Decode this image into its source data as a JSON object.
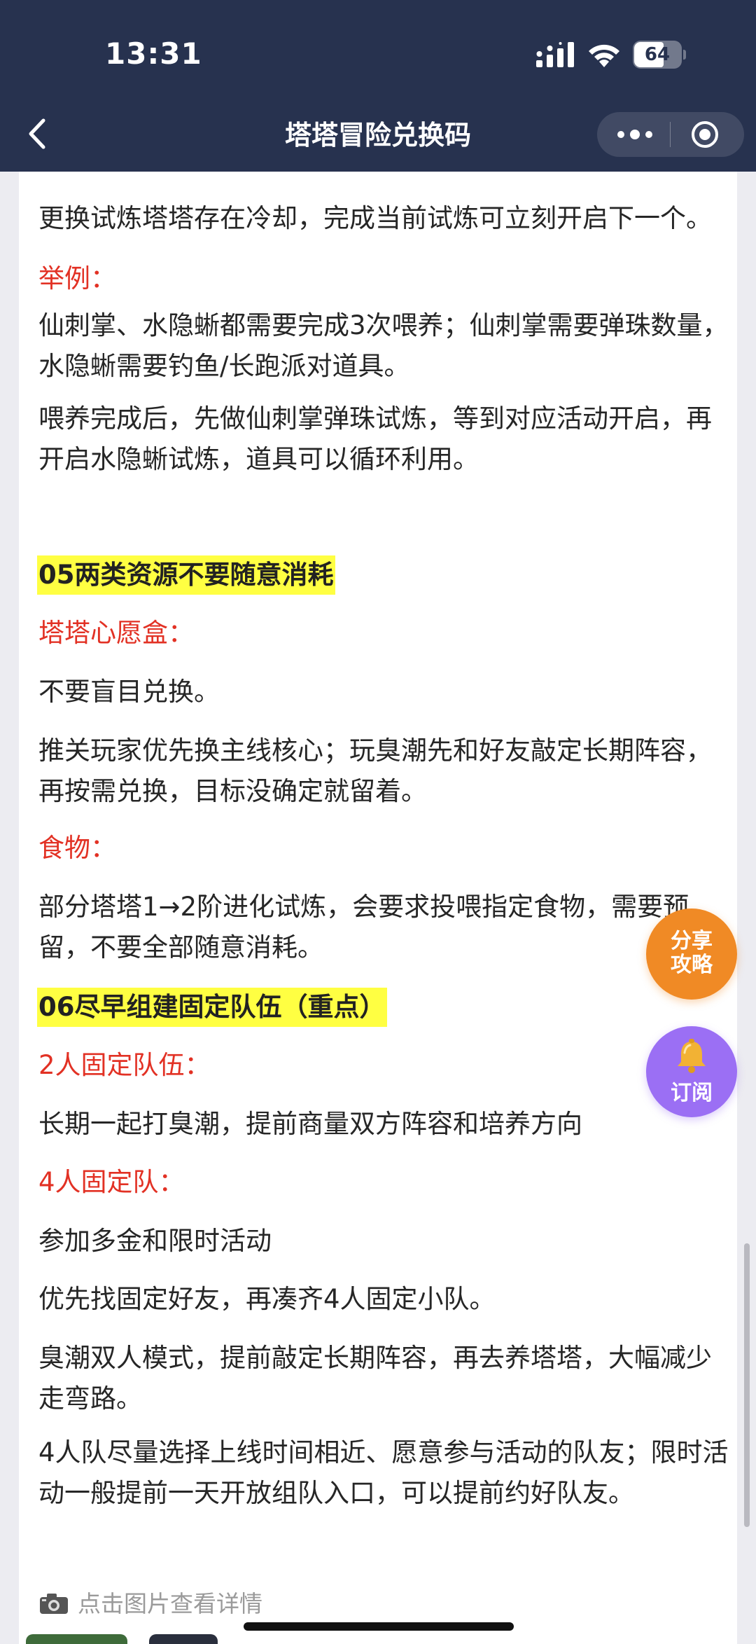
{
  "status_bar": {
    "time": "13:31",
    "battery": "64"
  },
  "nav": {
    "title": "塔塔冒险兑换码"
  },
  "article": {
    "p1": "更换试炼塔塔存在冷却，完成当前试炼可立刻开启下一个。",
    "example_label": "举例：",
    "p2": "仙刺掌、水隐蜥都需要完成3次喂养；仙刺掌需要弹珠数量，水隐蜥需要钓鱼/长跑派对道具。",
    "p3": "喂养完成后，先做仙刺掌弹珠试炼，等到对应活动开启，再开启水隐蜥试炼，道具可以循环利用。",
    "h05": "05两类资源不要随意消耗",
    "wish_box_label": "塔塔心愿盒：",
    "p4": "不要盲目兑换。",
    "p5": "推关玩家优先换主线核心；玩臭潮先和好友敲定长期阵容，再按需兑换，目标没确定就留着。",
    "food_label": "食物：",
    "p6": "部分塔塔1→2阶进化试炼，会要求投喂指定食物，需要预留，不要全部随意消耗。",
    "h06": "06尽早组建固定队伍（重点）",
    "team2_label": "2人固定队伍：",
    "p7": "长期一起打臭潮，提前商量双方阵容和培养方向",
    "team4_label": "4人固定队：",
    "p8": "参加多金和限时活动",
    "p9": "优先找固定好友，再凑齐4人固定小队。",
    "p10": "臭潮双人模式，提前敲定长期阵容，再去养塔塔，大幅减少走弯路。",
    "p11": "4人队尽量选择上线时间相近、愿意参与活动的队友；限时活动一般提前一天开放组队入口，可以提前约好队友。",
    "image_caption": "点击图片查看详情"
  },
  "floating": {
    "share_label": "分享攻略",
    "subscribe_label": "订阅"
  },
  "colors": {
    "header_bg": "#27324f",
    "highlight": "#ffff42",
    "red_label": "#e23124",
    "share_button": "#f08a25",
    "subscribe_button": "#9b6ff4"
  },
  "icons": [
    "back-arrow-icon",
    "more-dots-icon",
    "close-target-icon",
    "signal-icon",
    "wifi-icon",
    "battery-icon",
    "camera-icon",
    "bell-icon"
  ]
}
